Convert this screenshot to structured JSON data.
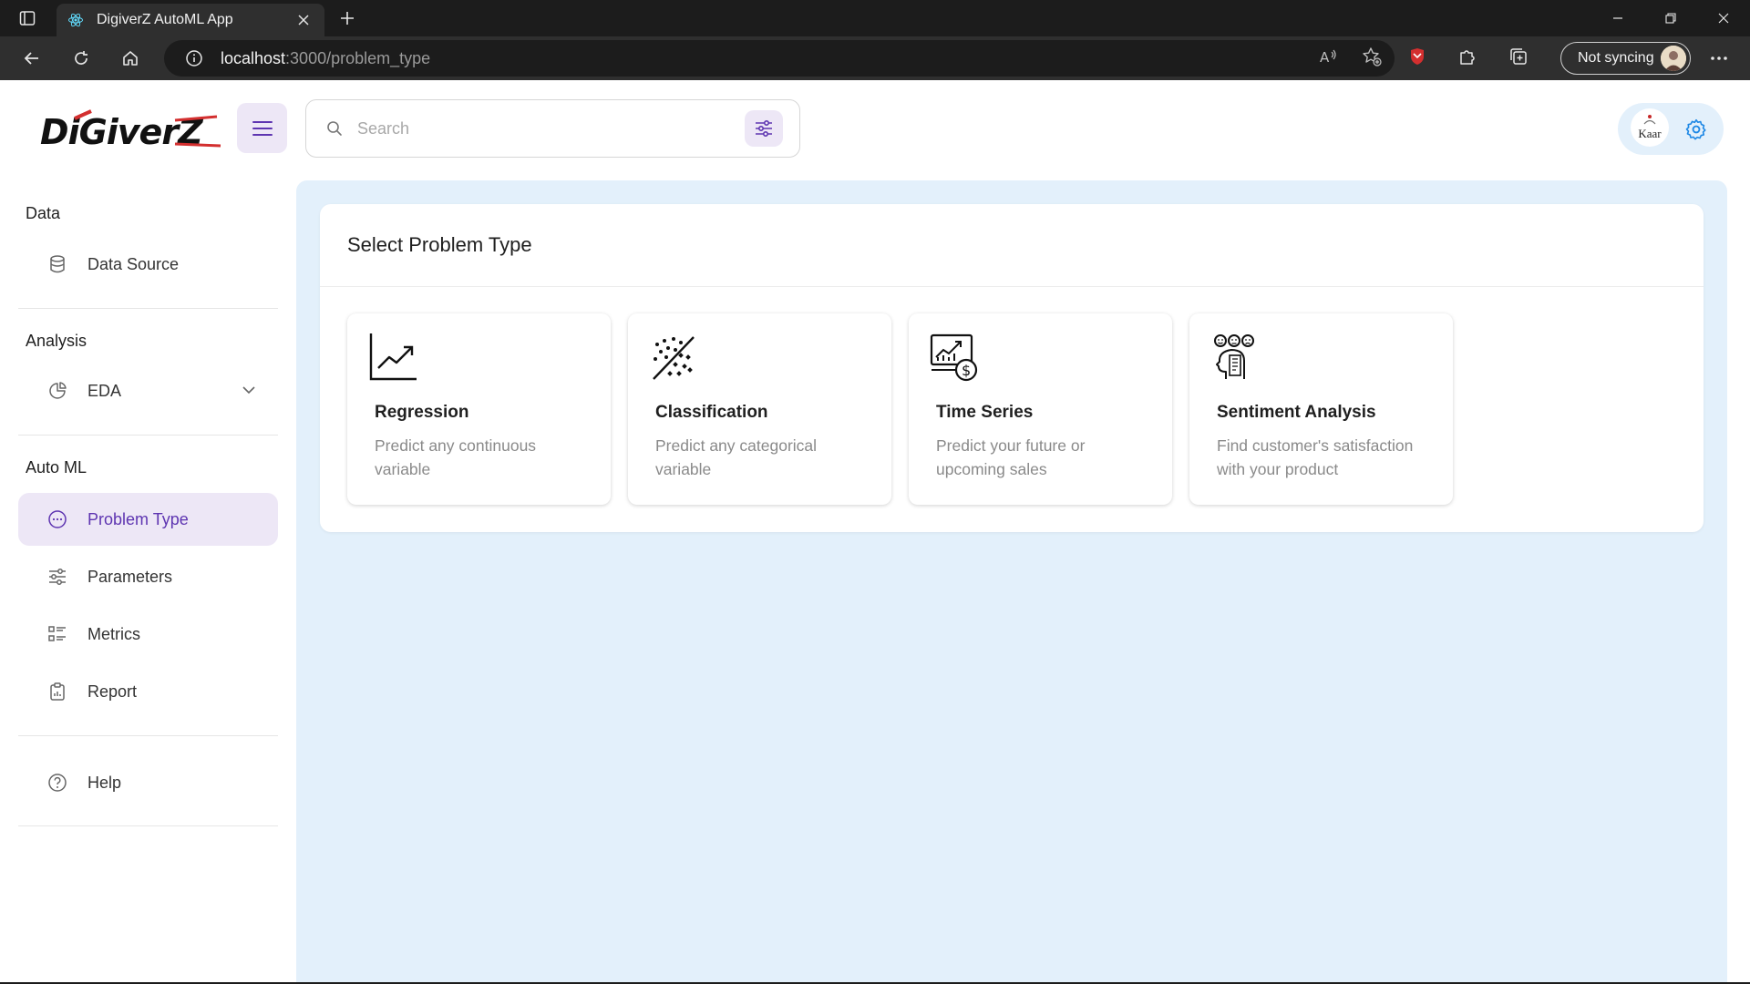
{
  "browser": {
    "tab_title": "DigiverZ AutoML App",
    "url_host": "localhost",
    "url_path": ":3000/problem_type",
    "sync_label": "Not syncing"
  },
  "header": {
    "search_placeholder": "Search",
    "profile_text": "Kaar"
  },
  "sidebar": {
    "sections": [
      {
        "title": "Data"
      },
      {
        "title": "Analysis"
      },
      {
        "title": "Auto ML"
      }
    ],
    "items": [
      {
        "label": "Data Source",
        "icon": "database-icon"
      },
      {
        "label": "EDA",
        "icon": "pie-chart-icon"
      },
      {
        "label": "Problem Type",
        "icon": "dots-circle-icon",
        "active": true
      },
      {
        "label": "Parameters",
        "icon": "sliders-icon"
      },
      {
        "label": "Metrics",
        "icon": "list-icon"
      },
      {
        "label": "Report",
        "icon": "clipboard-icon"
      },
      {
        "label": "Help",
        "icon": "help-circle-icon"
      }
    ]
  },
  "main": {
    "title": "Select Problem Type",
    "problem_types": [
      {
        "title": "Regression",
        "description": "Predict any continuous variable",
        "icon": "line-chart-icon"
      },
      {
        "title": "Classification",
        "description": "Predict any categorical variable",
        "icon": "scatter-dots-icon"
      },
      {
        "title": "Time Series",
        "description": "Predict your future or upcoming sales",
        "icon": "chart-dollar-icon"
      },
      {
        "title": "Sentiment Analysis",
        "description": "Find customer's satisfaction with your product",
        "icon": "head-emotions-icon"
      }
    ]
  },
  "colors": {
    "accent": "#5e35b1",
    "accent_light": "#ede7f6",
    "main_bg": "#e3f0fb",
    "chrome_dark": "#1c1c1c",
    "chrome": "#2f2f2f"
  }
}
